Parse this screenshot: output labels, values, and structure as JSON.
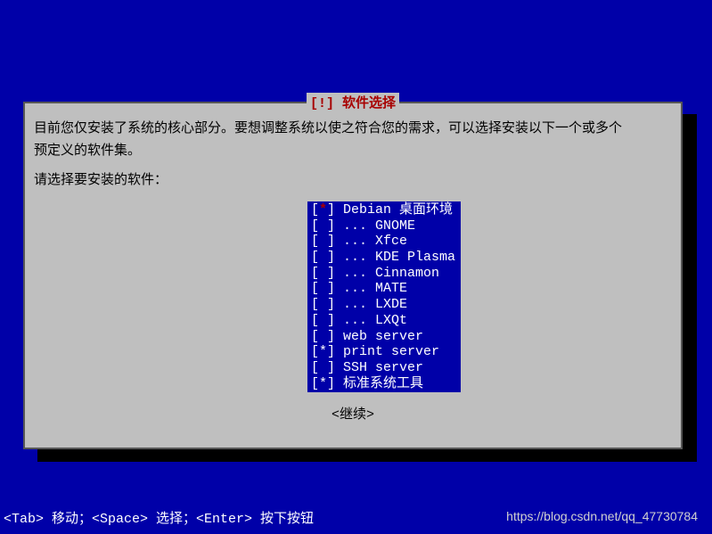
{
  "dialog": {
    "title": "[!] 软件选择",
    "description_line1": "目前您仅安装了系统的核心部分。要想调整系统以使之符合您的需求，可以选择安装以下一个或多个",
    "description_line2": "预定义的软件集。",
    "prompt": "请选择要安装的软件：",
    "continue_label": "<继续>"
  },
  "items": [
    {
      "checked": true,
      "label": "Debian 桌面环境"
    },
    {
      "checked": false,
      "label": "... GNOME"
    },
    {
      "checked": false,
      "label": "... Xfce"
    },
    {
      "checked": false,
      "label": "... KDE Plasma"
    },
    {
      "checked": false,
      "label": "... Cinnamon"
    },
    {
      "checked": false,
      "label": "... MATE"
    },
    {
      "checked": false,
      "label": "... LXDE"
    },
    {
      "checked": false,
      "label": "... LXQt"
    },
    {
      "checked": false,
      "label": "web server"
    },
    {
      "checked": true,
      "label": "print server"
    },
    {
      "checked": false,
      "label": "SSH server"
    },
    {
      "checked": true,
      "label": "标准系统工具"
    }
  ],
  "hints": "<Tab> 移动；<Space> 选择；<Enter> 按下按钮",
  "watermark": "https://blog.csdn.net/qq_47730784"
}
